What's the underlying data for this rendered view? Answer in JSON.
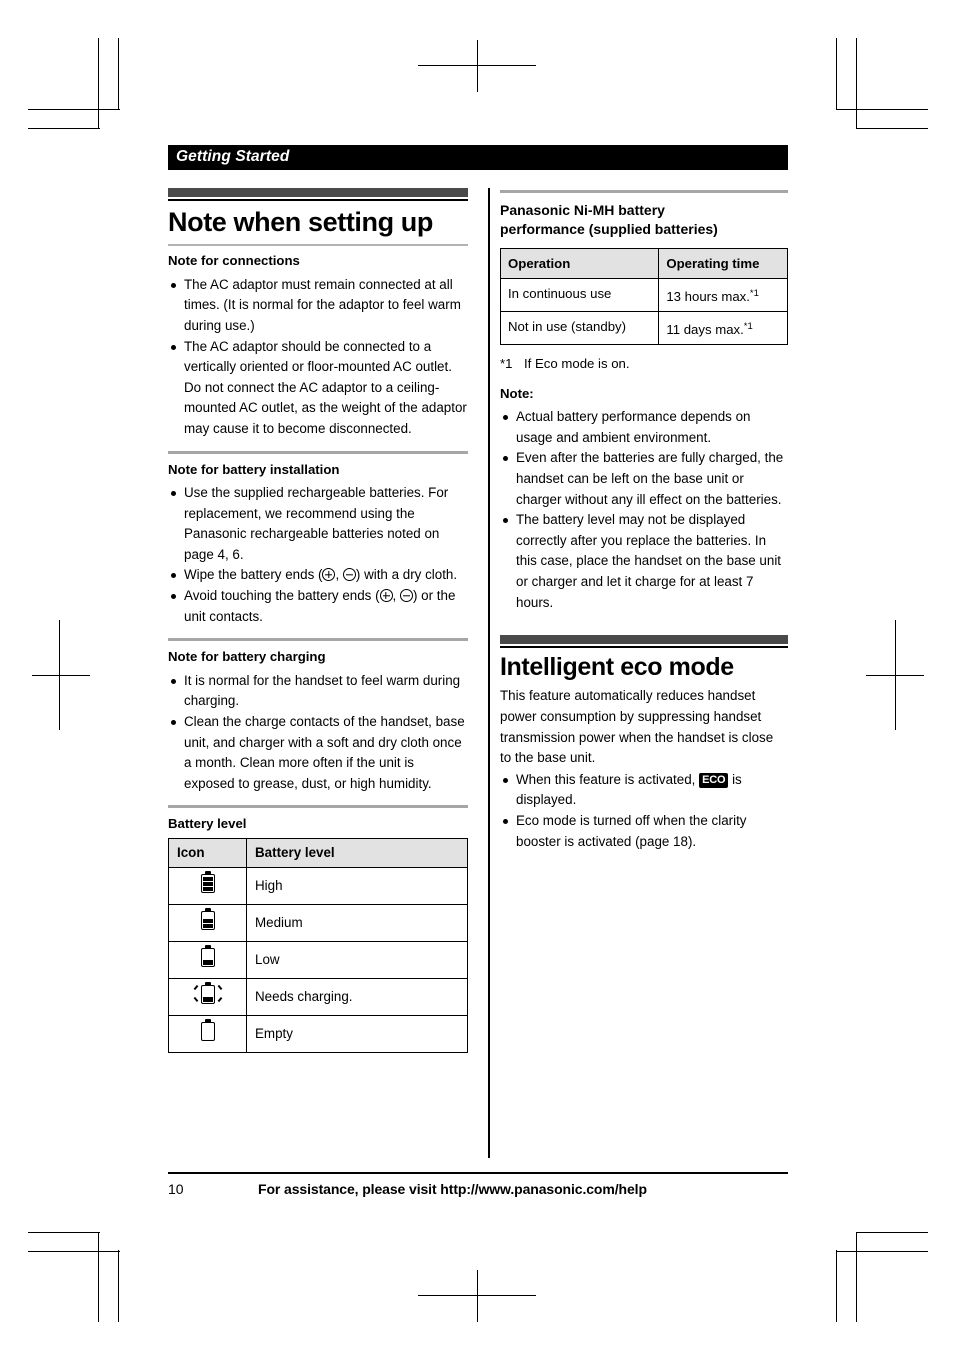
{
  "running_head": "Getting Started",
  "left_column": {
    "chapter_title": "Note when setting up",
    "sections": [
      {
        "heading": "Note for connections",
        "bullets": [
          "The AC adaptor must remain connected at all times. (It is normal for the adaptor to feel warm during use.)",
          "The AC adaptor should be connected to a vertically oriented or floor-mounted AC outlet. Do not connect the AC adaptor to a ceiling-mounted AC outlet, as the weight of the adaptor may cause it to become disconnected."
        ]
      },
      {
        "heading": "Note for battery installation",
        "bullets": [
          "Use the supplied rechargeable batteries. For replacement, we recommend using the Panasonic rechargeable batteries noted on page 4, 6.",
          "Wipe the battery ends (⊕, ⊖) with a dry cloth.",
          "Avoid touching the battery ends (⊕, ⊖) or the unit contacts."
        ],
        "bullet_parts": {
          "wipe_pre": "Wipe the battery ends (",
          "wipe_mid": ", ",
          "wipe_post": ") with a dry cloth.",
          "avoid_pre": "Avoid touching the battery ends (",
          "avoid_mid": ", ",
          "avoid_post": ") or the unit contacts."
        }
      },
      {
        "heading": "Note for battery charging",
        "bullets": [
          "It is normal for the handset to feel warm during charging.",
          "Clean the charge contacts of the handset, base unit, and charger with a soft and dry cloth once a month. Clean more often if the unit is exposed to grease, dust, or high humidity."
        ]
      }
    ],
    "battery_level": {
      "heading": "Battery level",
      "columns": [
        "Icon",
        "Battery level"
      ],
      "rows": [
        {
          "icon": "battery-high-icon",
          "level": "High"
        },
        {
          "icon": "battery-medium-icon",
          "level": "Medium"
        },
        {
          "icon": "battery-low-icon",
          "level": "Low"
        },
        {
          "icon": "battery-needs-charging-icon",
          "level": "Needs charging."
        },
        {
          "icon": "battery-empty-icon",
          "level": "Empty"
        }
      ]
    }
  },
  "right_column": {
    "battery_performance": {
      "heading_line1": "Panasonic Ni-MH battery",
      "heading_line2": "performance (supplied batteries)",
      "columns": [
        "Operation",
        "Operating time"
      ],
      "rows": [
        {
          "operation": "In continuous use",
          "time": "13 hours max.",
          "time_ref": "*1"
        },
        {
          "operation": "Not in use (standby)",
          "time": "11 days max.",
          "time_ref": "*1"
        }
      ],
      "footnote_tag": "*1",
      "footnote_text": "If Eco mode is on."
    },
    "note": {
      "heading": "Note:",
      "bullets": [
        "Actual battery performance depends on usage and ambient environment.",
        "Even after the batteries are fully charged, the handset can be left on the base unit or charger without any ill effect on the batteries.",
        "The battery level may not be displayed correctly after you replace the batteries. In this case, place the handset on the base unit or charger and let it charge for at least 7 hours."
      ]
    },
    "eco_mode": {
      "chapter_title": "Intelligent eco mode",
      "intro": "This feature automatically reduces handset power consumption by suppressing handset transmission power when the handset is close to the base unit.",
      "bullets": [
        {
          "pre": "When this feature is activated, ",
          "badge": "ECO",
          "post": " is displayed."
        },
        {
          "pre": "Eco mode is turned off when the clarity booster is activated (page 18).",
          "badge": "",
          "post": ""
        }
      ]
    }
  },
  "footer": {
    "page_number": "10",
    "assistance": "For assistance, please visit http://www.panasonic.com/help"
  },
  "colors": {
    "banner_gray": "#4a4a4a",
    "rule_gray": "#a6a6a6",
    "table_header_gray": "#e2e2e2",
    "ink": "#000000"
  }
}
